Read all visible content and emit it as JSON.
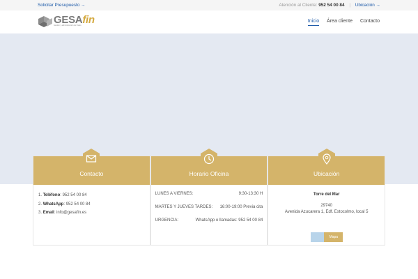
{
  "topbar": {
    "quote_link": "Solicitar Presupuesto →",
    "attention_label": "Atención al Cliente:",
    "phone": "952 54 00 84",
    "location_link": "Ubicación →"
  },
  "header": {
    "logo_word_main": "GESA",
    "logo_word_accent": "fin",
    "logo_tagline": "Gestión y administración de fincas",
    "nav": [
      "Inicio",
      "Área cliente",
      "Contacto"
    ],
    "active_nav": "Inicio"
  },
  "colors": {
    "accent": "#d4b46a",
    "link": "#1d5aa8",
    "hero_bg": "#e4e9f2"
  },
  "cards": [
    {
      "icon": "envelope-icon",
      "title": "Contacto",
      "items": [
        {
          "num": "1.",
          "label": "Teléfono",
          "value": ": 952 54 00 84"
        },
        {
          "num": "2.",
          "label": "WhatsApp",
          "value": ": 952 54 00 84"
        },
        {
          "num": "3.",
          "label": "Email",
          "value": ": info@gesafin.es"
        }
      ]
    },
    {
      "icon": "clock-icon",
      "title": "Horario Oficina",
      "rows": [
        {
          "key": "LUNES A VIERNES:",
          "value": "9:30-13:30 H"
        },
        {
          "key": "MARTES Y JUEVES TARDES:",
          "value": "16:00-19:00 Previa cita"
        },
        {
          "key": "URGENCIA:",
          "value": "WhatsApp o llamadas: 952 54 00 84"
        }
      ]
    },
    {
      "icon": "map-pin-icon",
      "title": "Ubicación",
      "place": "Torre del Mar",
      "postal": "29740",
      "address": "Avenida Azucarera 1, Edf. Estocolmo, local 5",
      "tabs": [
        "",
        "Mapa"
      ]
    }
  ]
}
